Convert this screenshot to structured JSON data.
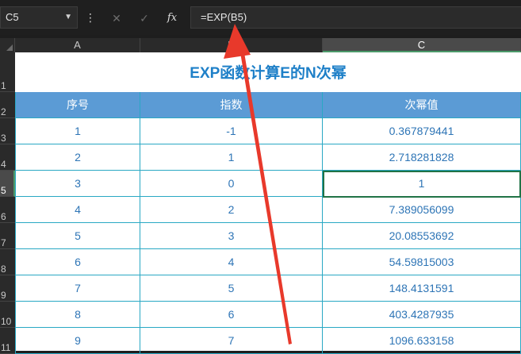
{
  "formula_bar": {
    "name_box": "C5",
    "more_glyph": "⋮",
    "cancel_glyph": "✕",
    "enter_glyph": "✓",
    "fx_label": "fx",
    "formula": "=EXP(B5)"
  },
  "columns": [
    "A",
    "B",
    "C"
  ],
  "row_numbers": [
    "1",
    "2",
    "3",
    "4",
    "5",
    "6",
    "7",
    "8",
    "9",
    "10",
    "11"
  ],
  "selected_cell": "C5",
  "table": {
    "title": "EXP函数计算E的N次幂",
    "headers": [
      "序号",
      "指数",
      "次幂值"
    ],
    "rows": [
      [
        "1",
        "-1",
        "0.367879441"
      ],
      [
        "2",
        "1",
        "2.718281828"
      ],
      [
        "3",
        "0",
        "1"
      ],
      [
        "4",
        "2",
        "7.389056099"
      ],
      [
        "5",
        "3",
        "20.08553692"
      ],
      [
        "6",
        "4",
        "54.59815003"
      ],
      [
        "7",
        "5",
        "148.4131591"
      ],
      [
        "8",
        "6",
        "403.4287935"
      ],
      [
        "9",
        "7",
        "1096.633158"
      ]
    ]
  },
  "colors": {
    "accent_title": "#1f80c8",
    "header_fill": "#5b9bd5",
    "cell_text": "#2e75b6",
    "border": "#29a8c4",
    "selection": "#217346",
    "annotation_arrow": "#e8392b"
  }
}
